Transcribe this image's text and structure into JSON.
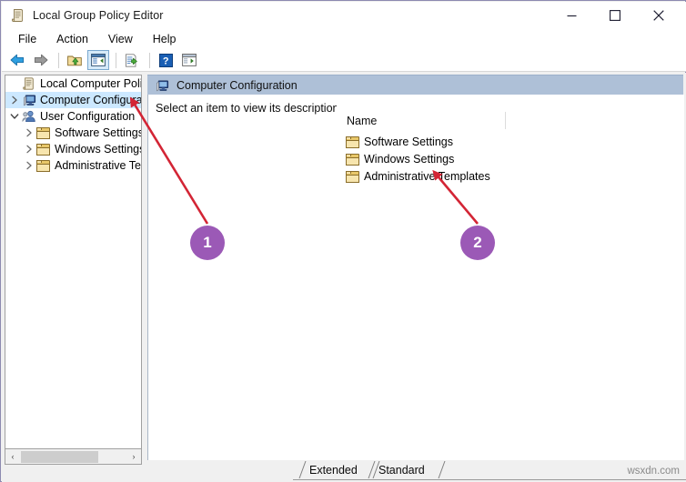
{
  "window": {
    "title": "Local Group Policy Editor",
    "app_icon": "policy-document-icon",
    "controls": {
      "minimize": "minimize-button",
      "maximize": "maximize-button",
      "close": "close-button"
    }
  },
  "menubar": {
    "items": [
      {
        "label": "File"
      },
      {
        "label": "Action"
      },
      {
        "label": "View"
      },
      {
        "label": "Help"
      }
    ]
  },
  "toolbar": {
    "buttons": [
      {
        "name": "back-icon"
      },
      {
        "name": "forward-icon"
      },
      {
        "name": "up-folder-icon"
      },
      {
        "name": "show-hide-console-tree-icon"
      },
      {
        "name": "export-list-icon"
      },
      {
        "name": "help-icon"
      },
      {
        "name": "show-hide-action-pane-icon"
      }
    ]
  },
  "tree": {
    "items": [
      {
        "label": "Local Computer Policy",
        "icon": "policy-document-icon",
        "indent": 0,
        "expander": "none",
        "selected": false
      },
      {
        "label": "Computer Configuration",
        "icon": "computer-icon",
        "indent": 0,
        "expander": "collapsed",
        "selected": true
      },
      {
        "label": "User Configuration",
        "icon": "user-icon",
        "indent": 0,
        "expander": "expanded",
        "selected": false
      },
      {
        "label": "Software Settings",
        "icon": "folder-icon",
        "indent": 1,
        "expander": "collapsed",
        "selected": false
      },
      {
        "label": "Windows Settings",
        "icon": "folder-icon",
        "indent": 1,
        "expander": "collapsed",
        "selected": false
      },
      {
        "label": "Administrative Templates",
        "icon": "folder-icon",
        "indent": 1,
        "expander": "collapsed",
        "selected": false
      }
    ],
    "scrollbar": {
      "left_arrow": "‹",
      "right_arrow": "›"
    }
  },
  "right_pane": {
    "header": {
      "title": "Computer Configuration",
      "icon": "computer-icon"
    },
    "description": "Select an item to view its description.",
    "list": {
      "column_header": "Name",
      "rows": [
        {
          "label": "Software Settings",
          "icon": "folder-icon"
        },
        {
          "label": "Windows Settings",
          "icon": "folder-icon"
        },
        {
          "label": "Administrative Templates",
          "icon": "folder-icon"
        }
      ]
    },
    "tabs": [
      {
        "label": "Extended",
        "selected": false
      },
      {
        "label": "Standard",
        "selected": true
      }
    ]
  },
  "annotations": {
    "badges": [
      {
        "number": "1",
        "color": "#9b59b6"
      },
      {
        "number": "2",
        "color": "#9b59b6"
      }
    ],
    "arrow_color": "#d32535"
  },
  "watermark": "wsxdn.com"
}
